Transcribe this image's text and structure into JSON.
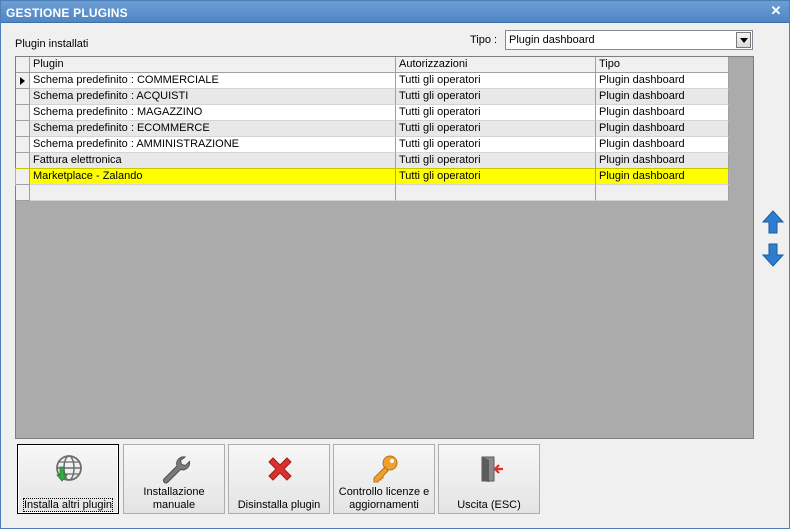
{
  "window": {
    "title": "GESTIONE PLUGINS",
    "close_label": "✕"
  },
  "installed_label": "Plugin installati",
  "tipo": {
    "label": "Tipo :",
    "value": "Plugin dashboard"
  },
  "grid": {
    "columns": [
      "Plugin",
      "Autorizzazioni",
      "Tipo"
    ],
    "rows": [
      {
        "plugin": "Schema predefinito : COMMERCIALE",
        "aut": "Tutti gli operatori",
        "tipo": "Plugin dashboard"
      },
      {
        "plugin": "Schema predefinito : ACQUISTI",
        "aut": "Tutti gli operatori",
        "tipo": "Plugin dashboard"
      },
      {
        "plugin": "Schema predefinito : MAGAZZINO",
        "aut": "Tutti gli operatori",
        "tipo": "Plugin dashboard"
      },
      {
        "plugin": "Schema predefinito : ECOMMERCE",
        "aut": "Tutti gli operatori",
        "tipo": "Plugin dashboard"
      },
      {
        "plugin": "Schema predefinito : AMMINISTRAZIONE",
        "aut": "Tutti gli operatori",
        "tipo": "Plugin dashboard"
      },
      {
        "plugin": "Fattura elettronica",
        "aut": "Tutti gli operatori",
        "tipo": "Plugin dashboard"
      },
      {
        "plugin": "Marketplace - Zalando",
        "aut": "Tutti gli operatori",
        "tipo": "Plugin dashboard"
      }
    ]
  },
  "side_buttons": {
    "up_icon": "arrow-up-icon",
    "down_icon": "arrow-down-icon"
  },
  "toolbar": {
    "install_more": "Installa altri plugin",
    "manual_line1": "Installazione",
    "manual_line2": "manuale",
    "uninstall": "Disinstalla plugin",
    "license_line1": "Controllo licenze e",
    "license_line2": "aggiornamenti",
    "exit": "Uscita (ESC)"
  },
  "colors": {
    "titlebar": "#4f86c6",
    "selected_row": "#ffff00",
    "grid_bg": "#ababab",
    "arrow_blue": "#2e7dd1",
    "uninstall_red": "#d9312b",
    "key_orange": "#f0a030"
  }
}
